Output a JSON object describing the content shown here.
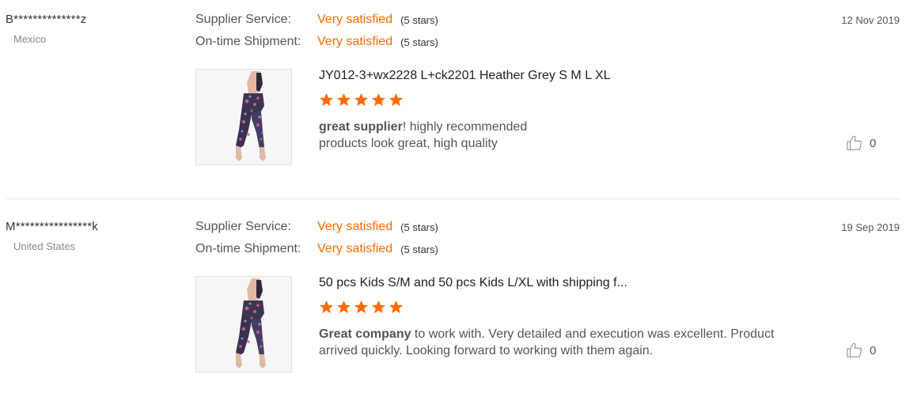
{
  "colors": {
    "accent": "#ff6a00",
    "text": "#333333",
    "muted": "#888888",
    "divider": "#e5e5e5"
  },
  "reviews": [
    {
      "buyer": "B**************z",
      "country": "Mexico",
      "date": "12 Nov 2019",
      "ratings": [
        {
          "label": "Supplier Service:",
          "value": "Very satisfied",
          "stars_text": "(5 stars)"
        },
        {
          "label": "On-time Shipment:",
          "value": "Very satisfied",
          "stars_text": "(5 stars)"
        }
      ],
      "product_title": "JY012-3+wx2228 L+ck2201 Heather Grey S M L XL",
      "product_stars": 5,
      "comment_lead": "great supplier",
      "comment_line1": "! highly recommended",
      "comment_line2": "products look great, high quality",
      "likes": "0",
      "icons": {
        "like": "thumbs-up-icon",
        "star": "star-icon"
      }
    },
    {
      "buyer": "M****************k",
      "country": "United States",
      "date": "19 Sep 2019",
      "ratings": [
        {
          "label": "Supplier Service:",
          "value": "Very satisfied",
          "stars_text": "(5 stars)"
        },
        {
          "label": "On-time Shipment:",
          "value": "Very satisfied",
          "stars_text": "(5 stars)"
        }
      ],
      "product_title": "50 pcs Kids S/M and 50 pcs Kids L/XL with shipping f...",
      "product_stars": 5,
      "comment_lead": "Great company",
      "comment_line1": " to work with. Very detailed and execution was excellent. Product",
      "comment_line2": "arrived quickly.  Looking forward to working with them again.",
      "likes": "0",
      "icons": {
        "like": "thumbs-up-icon",
        "star": "star-icon"
      }
    }
  ]
}
